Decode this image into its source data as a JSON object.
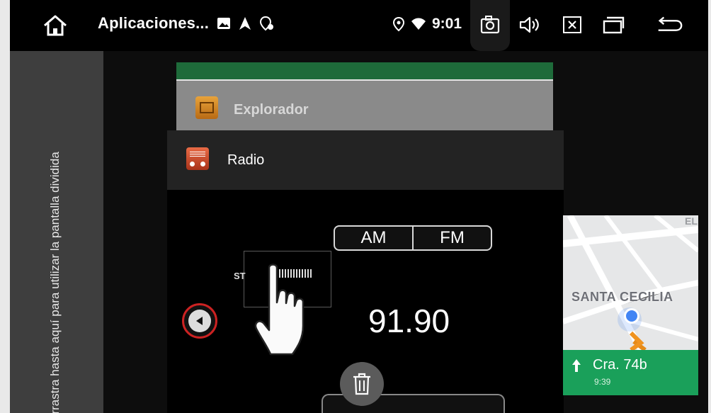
{
  "statusbar": {
    "app_title": "Aplicaciones...",
    "time": "9:01",
    "icons_left": [
      "image-icon",
      "navigation-icon",
      "location-settings-icon"
    ],
    "icons_right": [
      "location-pin-icon",
      "wifi-icon"
    ],
    "nav_buttons": [
      "camera-icon",
      "volume-icon",
      "close-window-icon",
      "recents-icon",
      "back-icon"
    ]
  },
  "split": {
    "hint": "Arrastra hasta aquí para utilizar la pantalla dividida"
  },
  "recents": {
    "explorer_title": "Explorador",
    "radio_title": "Radio"
  },
  "radio": {
    "band_am": "AM",
    "band_fm": "FM",
    "stereo": "ST",
    "frequency": "91.90"
  },
  "map": {
    "place": "SANTA CECILIA",
    "corner_text": "EL",
    "street": "Cra. 74b",
    "eta": "9:39"
  },
  "colors": {
    "accent_green": "#1aa05a",
    "header_green": "#1e6b3a",
    "prev_ring": "#cc2222"
  }
}
